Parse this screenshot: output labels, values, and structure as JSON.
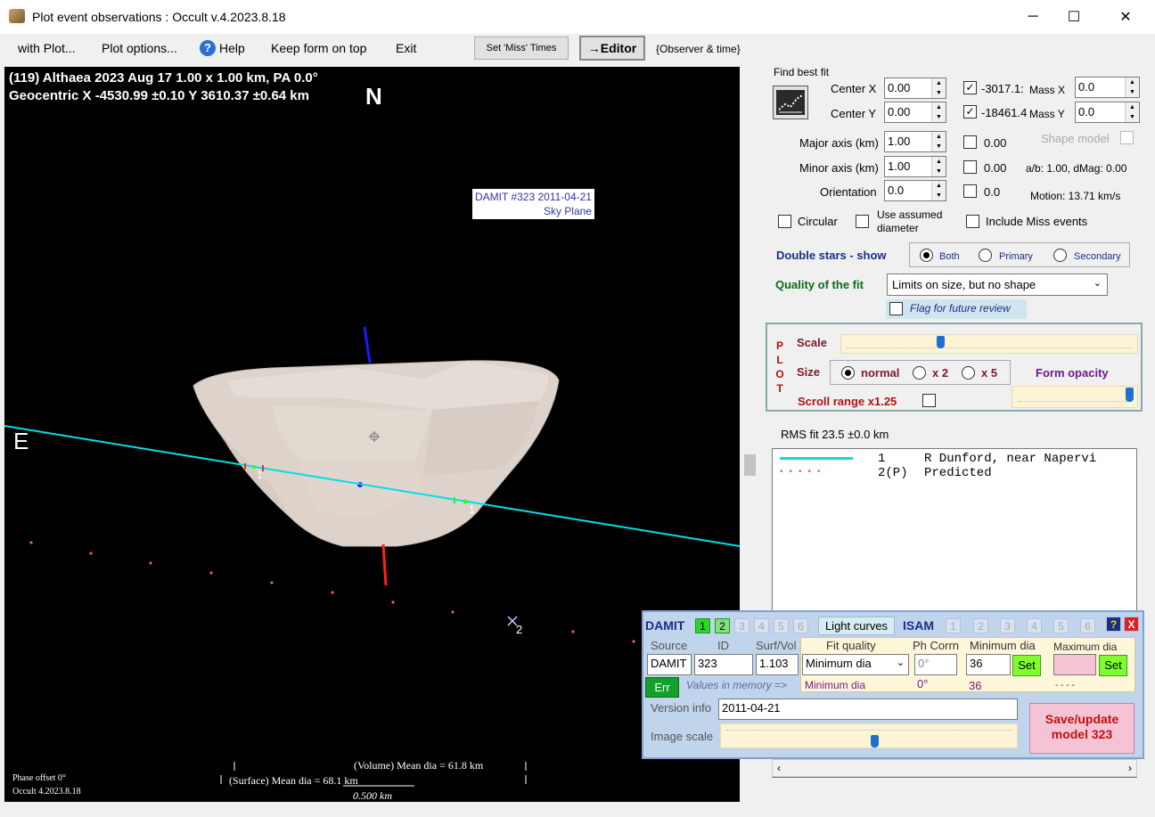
{
  "window": {
    "title": "Plot event observations : Occult v.4.2023.8.18",
    "controls": [
      "─",
      "☐",
      "✕"
    ]
  },
  "menu": {
    "items": [
      "with Plot...",
      "Plot options...",
      "Help",
      "Keep form on top",
      "Exit"
    ],
    "set_miss_times": "Set 'Miss' Times",
    "editor": "→Editor",
    "observer_time": "{Observer & time}"
  },
  "plot": {
    "line1": "(119) Althaea  2023 Aug 17  1.00 x 1.00 km, PA 0.0°",
    "line2": "Geocentric  X  -4530.99 ±0.10  Y 3610.37 ±0.64 km",
    "north": "N",
    "east": "E",
    "model_label_1": "DAMIT #323 2011-04-21",
    "model_label_2": "Sky Plane",
    "chord_label_left": "1",
    "chord_label_right": "1",
    "miss_label": "2",
    "volume_dia": "(Volume) Mean dia = 61.8 km",
    "surface_dia": "(Surface) Mean dia = 68.1 km",
    "scale_km": "0.500 km",
    "phase_offset": "Phase offset 0°",
    "version": "Occult 4.2023.8.18",
    "colors": {
      "chord": "#00e0e6",
      "predicted": "#e05a8a",
      "axis_b": "#1a1aff",
      "axis_r": "#ff2020"
    }
  },
  "fit": {
    "find_best_fit": "Find best fit",
    "center_x_label": "Center X",
    "center_x": "0.00",
    "center_y_label": "Center Y",
    "center_y": "0.00",
    "center_x_result": "-3017.1:",
    "center_y_result": "-18461.4",
    "mass_x_label": "Mass X",
    "mass_x": "0.0",
    "mass_y_label": "Mass Y",
    "mass_y": "0.0",
    "major_label": "Major axis (km)",
    "major": "1.00",
    "major_result": "0.00",
    "minor_label": "Minor axis (km)",
    "minor": "1.00",
    "minor_result": "0.00",
    "orient_label": "Orientation",
    "orient": "0.0",
    "orient_result": "0.0",
    "shape_model": "Shape model",
    "ab_dmag": "a/b: 1.00, dMag: 0.00",
    "motion": "Motion: 13.71 km/s",
    "circular": "Circular",
    "use_assumed": "Use assumed diameter",
    "include_miss": "Include Miss events",
    "double_stars": "Double stars - show",
    "both": "Both",
    "primary": "Primary",
    "secondary": "Secondary",
    "quality_label": "Quality of the fit",
    "quality_value": "Limits on size, but no shape",
    "flag_review": "Flag for future review"
  },
  "plotbox": {
    "letters": [
      "P",
      "L",
      "O",
      "T"
    ],
    "scale": "Scale",
    "size": "Size",
    "normal": "normal",
    "x2": "x 2",
    "x5": "x 5",
    "form_opacity": "Form opacity",
    "scroll_range": "Scroll range x1.25",
    "scale_level": 0.33,
    "opacity_level": 0.97
  },
  "rms": "RMS fit 23.5 ±0.0 km",
  "legend": [
    {
      "num": "1",
      "text": "R Dunford, near Napervi"
    },
    {
      "num": "2(P)",
      "text": "Predicted"
    }
  ],
  "damit": {
    "title": "DAMIT",
    "nums_left": [
      "1",
      "2",
      "3",
      "4",
      "5",
      "6"
    ],
    "light_curves": "Light curves",
    "isam": "ISAM",
    "nums_right": [
      "1",
      "2",
      "3",
      "4",
      "5",
      "6"
    ],
    "help": "?",
    "close": "X",
    "source_label": "Source",
    "id_label": "ID",
    "surfvol_label": "Surf/Vol",
    "source": "DAMIT",
    "id": "323",
    "surfvol": "1.103",
    "fit_quality_label": "Fit quality",
    "phcorr_label": "Ph Corrn",
    "min_dia_label": "Minimum dia",
    "max_dia_label": "Maximum dia",
    "fit_quality": "Minimum dia",
    "phcorr": "0°",
    "min_dia": "36",
    "max_dia": "",
    "set1": "Set",
    "set2": "Set",
    "err": "Err",
    "values_in_memory": "Values in memory =>",
    "mem_fit": "Minimum dia",
    "mem_ph": "0°",
    "mem_min": "36",
    "mem_max": "- - - -",
    "version_label": "Version info",
    "version": "2011-04-21",
    "image_scale": "Image scale",
    "image_scale_level": 0.52,
    "save_update": "Save/update model 323"
  }
}
